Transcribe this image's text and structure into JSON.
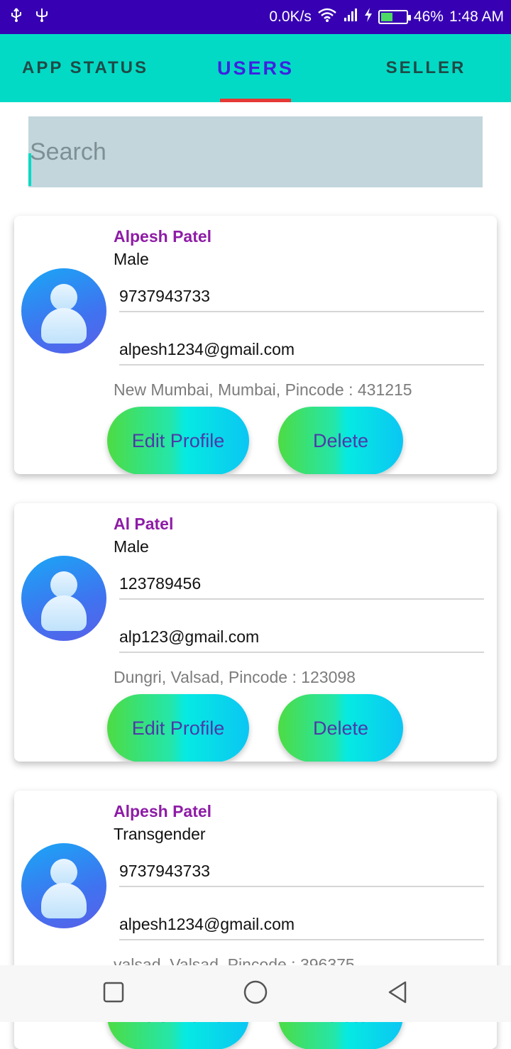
{
  "status_bar": {
    "left_icons": [
      "usb-icon",
      "usb-icon"
    ],
    "net_speed": "0.0K/s",
    "battery_level": 0.46,
    "battery": "46%",
    "time": "1:48 AM"
  },
  "tabs": [
    {
      "label": "APP STATUS",
      "active": false
    },
    {
      "label": "USERS",
      "active": true
    },
    {
      "label": "SELLER",
      "active": false
    }
  ],
  "search": {
    "placeholder": "Search",
    "value": ""
  },
  "users": [
    {
      "name": "Alpesh Patel",
      "gender": "Male",
      "phone": "9737943733",
      "email": "alpesh1234@gmail.com",
      "address": "New Mumbai, Mumbai, Pincode : 431215"
    },
    {
      "name": "Al Patel",
      "gender": "Male",
      "phone": "123789456",
      "email": "alp123@gmail.com",
      "address": "Dungri, Valsad, Pincode : 123098"
    },
    {
      "name": "Alpesh Patel",
      "gender": "Transgender",
      "phone": "9737943733",
      "email": "alpesh1234@gmail.com",
      "address": "valsad, Valsad, Pincode : 396375"
    }
  ],
  "buttons": {
    "edit": "Edit Profile",
    "delete": "Delete"
  },
  "colors": {
    "status_bar": "#3700b3",
    "tab_bar": "#03dac5",
    "active_tab": "#3d22e0",
    "indicator": "#e53935",
    "user_name": "#8e1ca6"
  }
}
